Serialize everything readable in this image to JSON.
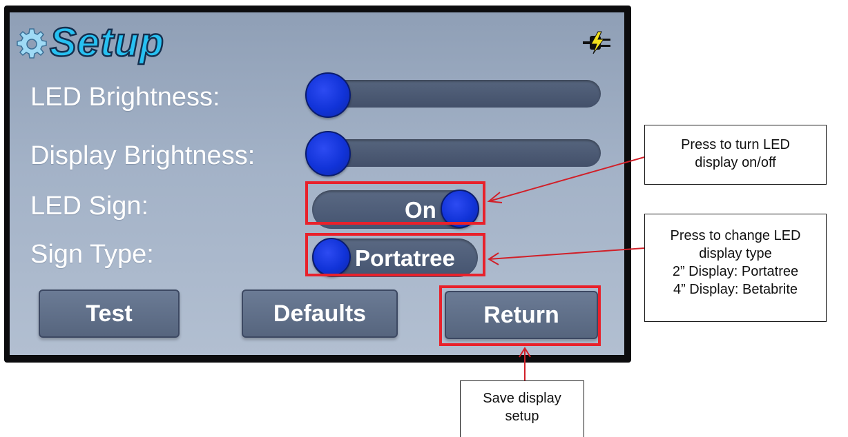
{
  "screen": {
    "title": "Setup",
    "icons": {
      "title_icon": "gear-icon",
      "status_icon": "power-plug-icon"
    },
    "rows": {
      "led_brightness": {
        "label": "LED Brightness:",
        "value_percent": 0
      },
      "display_brightness": {
        "label": "Display Brightness:",
        "value_percent": 0
      },
      "led_sign": {
        "label": "LED Sign:",
        "toggle_text": "On",
        "state": "on"
      },
      "sign_type": {
        "label": "Sign Type:",
        "toggle_text": "Portatree"
      }
    },
    "buttons": {
      "test": "Test",
      "defaults": "Defaults",
      "return": "Return"
    }
  },
  "annotations": {
    "led_toggle": [
      "Press to turn LED",
      "display on/off"
    ],
    "sign_type": [
      "Press to change LED",
      "display type",
      "2” Display: Portatree",
      "4” Display: Betabrite"
    ],
    "return": [
      "Save display",
      "setup"
    ]
  },
  "colors": {
    "highlight": "#e8212b",
    "knob": "#1133d8",
    "title": "#27c1f2"
  }
}
